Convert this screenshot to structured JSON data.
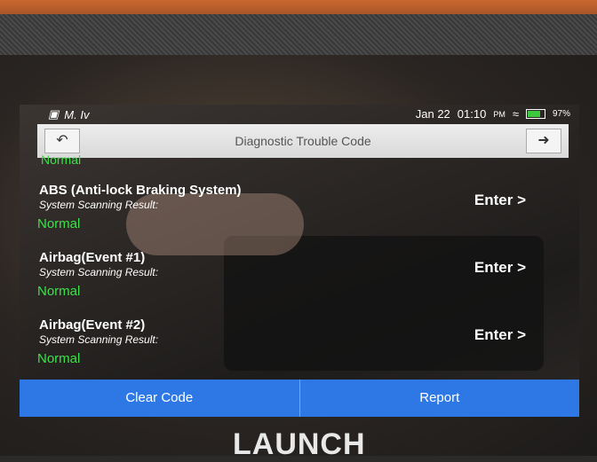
{
  "status_bar": {
    "left_text": "M. Iv",
    "date": "Jan 22",
    "time": "01:10",
    "ampm": "PM",
    "battery": "97%"
  },
  "header": {
    "title": "Diagnostic Trouble Code",
    "back_icon": "back-arrow-icon",
    "exit_icon": "exit-door-icon"
  },
  "previous_item_status": "Normal",
  "systems": [
    {
      "name": "ABS (Anti-lock Braking System)",
      "result_label": "System Scanning Result:",
      "status": "Normal",
      "action": "Enter >"
    },
    {
      "name": "Airbag(Event #1)",
      "result_label": "System Scanning Result:",
      "status": "Normal",
      "action": "Enter >"
    },
    {
      "name": "Airbag(Event #2)",
      "result_label": "System Scanning Result:",
      "status": "Normal",
      "action": "Enter >"
    }
  ],
  "footer": {
    "clear_code": "Clear Code",
    "report": "Report"
  },
  "device": {
    "brand": "LAUNCH"
  },
  "colors": {
    "normal_status": "#3fe04a",
    "footer_blue": "#2e78e6"
  }
}
